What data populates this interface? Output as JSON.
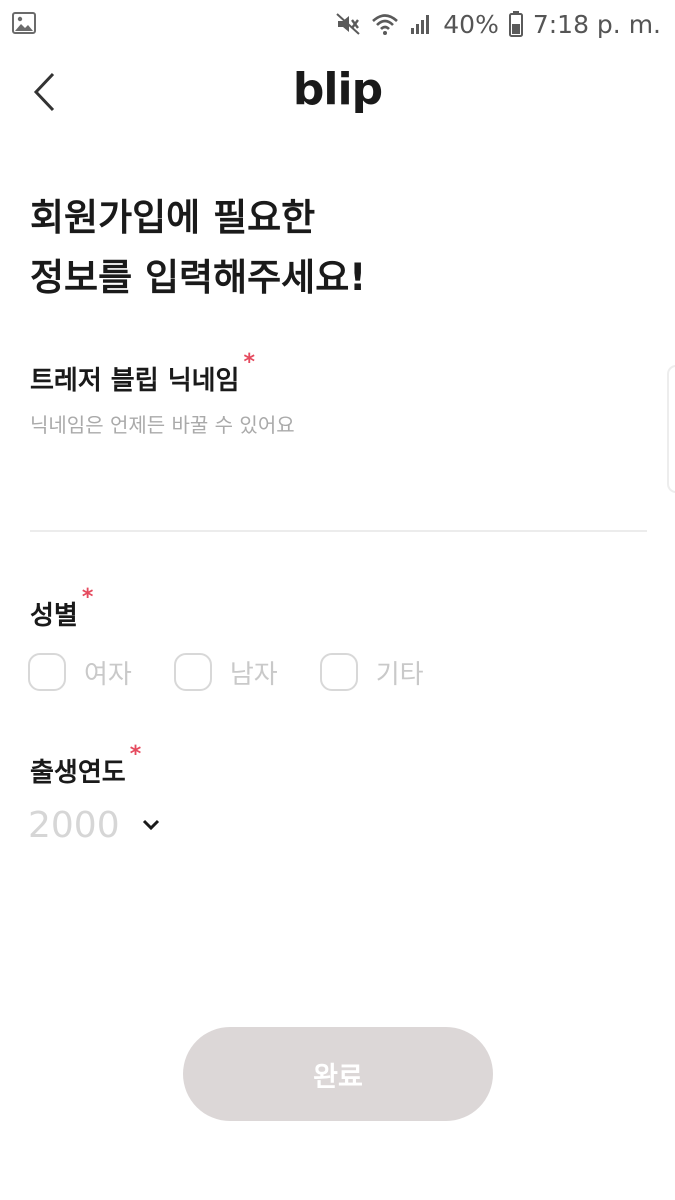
{
  "status_bar": {
    "battery": "40%",
    "time": "7:18 p. m."
  },
  "header": {
    "logo": "blip"
  },
  "form": {
    "title_line1": "회원가입에 필요한",
    "title_line2": "정보를 입력해주세요!",
    "required_mark": "*",
    "nickname": {
      "label": "트레저 블립 닉네임",
      "placeholder": "닉네임은 언제든 바꿀 수 있어요",
      "value": ""
    },
    "gender": {
      "label": "성별",
      "options": [
        "여자",
        "남자",
        "기타"
      ]
    },
    "birth_year": {
      "label": "출생연도",
      "value": "2000"
    },
    "submit_label": "완료"
  }
}
